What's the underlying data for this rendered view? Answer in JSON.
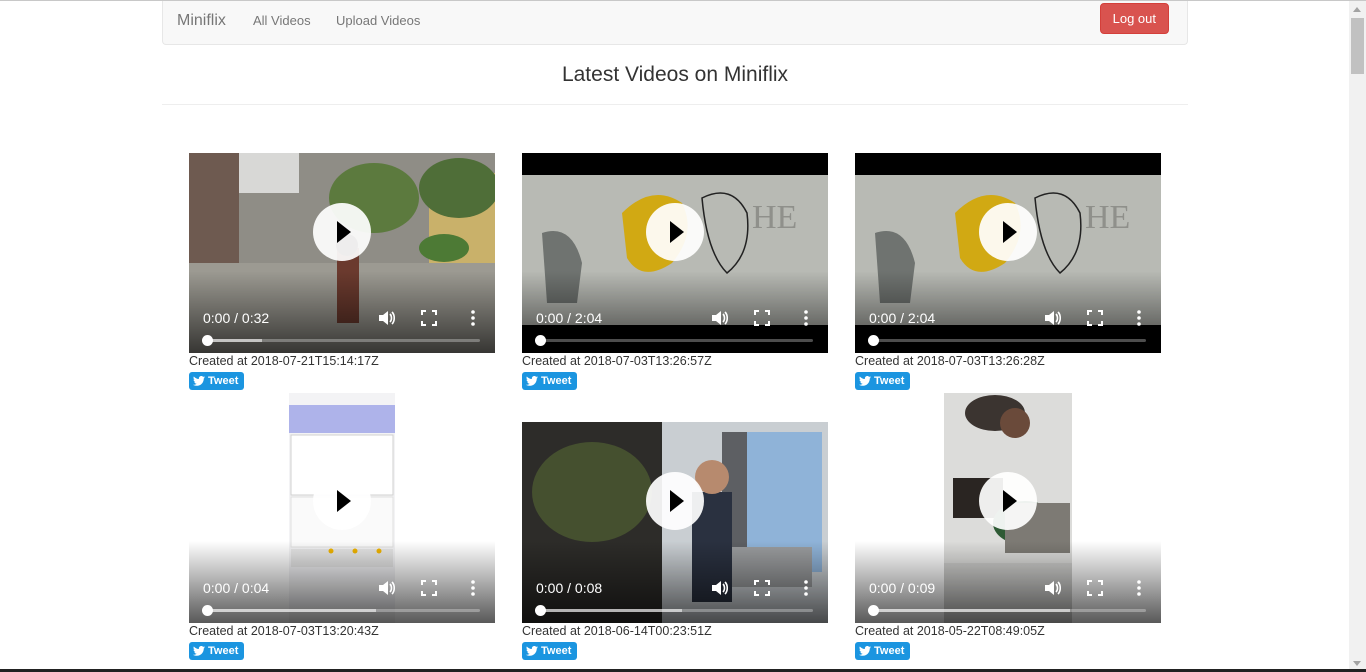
{
  "navbar": {
    "brand": "Miniflix",
    "links": [
      "All Videos",
      "Upload Videos"
    ],
    "logout_label": "Log out"
  },
  "heading": "Latest Videos on Miniflix",
  "videos": [
    {
      "time": "0:00 / 0:32",
      "created": "Created at 2018-07-21T15:14:17Z",
      "tweet": "Tweet",
      "buffered": 0.2,
      "thumb": "rainy-courtyard"
    },
    {
      "time": "0:00 / 2:04",
      "created": "Created at 2018-07-03T13:26:57Z",
      "tweet": "Tweet",
      "buffered": 0.0,
      "thumb": "pie-logo"
    },
    {
      "time": "0:00 / 2:04",
      "created": "Created at 2018-07-03T13:26:28Z",
      "tweet": "Tweet",
      "buffered": 0.0,
      "thumb": "pie-logo"
    },
    {
      "time": "0:00 / 0:04",
      "created": "Created at 2018-07-03T13:20:43Z",
      "tweet": "Tweet",
      "buffered": 0.62,
      "thumb": "phone-screen"
    },
    {
      "time": "0:00 / 0:08",
      "created": "Created at 2018-06-14T00:23:51Z",
      "tweet": "Tweet",
      "buffered": 0.52,
      "thumb": "man-at-window"
    },
    {
      "time": "0:00 / 0:09",
      "created": "Created at 2018-05-22T08:49:05Z",
      "tweet": "Tweet",
      "buffered": 0.72,
      "thumb": "people-vertical"
    }
  ],
  "colors": {
    "logout": "#d9534f",
    "tweet": "#1b95e0",
    "navbar_bg": "#f8f8f8"
  }
}
